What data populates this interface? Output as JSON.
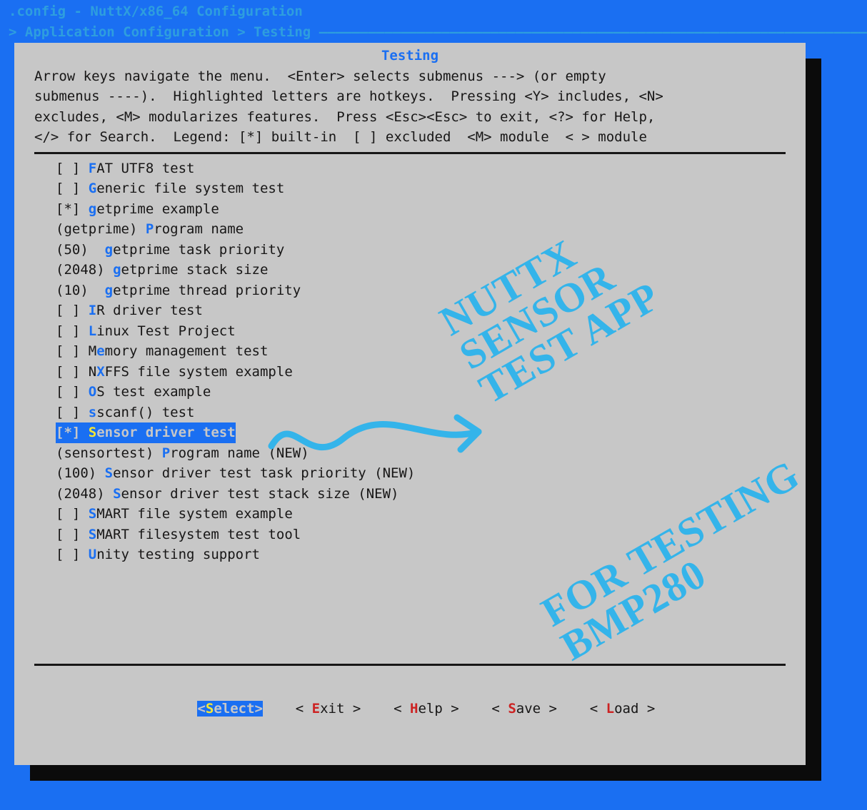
{
  "header": {
    "line1": ".config - NuttX/x86_64 Configuration",
    "line2_prefix": "> Application Configuration > Testing ",
    "line2_rule": "—————————————————————————————————————————————————————————————————————————————————"
  },
  "panel": {
    "title": "Testing",
    "help": [
      "Arrow keys navigate the menu.  <Enter> selects submenus ---> (or empty",
      "submenus ----).  Highlighted letters are hotkeys.  Pressing <Y> includes, <N>",
      "excludes, <M> modularizes features.  Press <Esc><Esc> to exit, <?> for Help,",
      "</> for Search.  Legend: [*] built-in  [ ] excluded  <M> module  < > module"
    ]
  },
  "items": [
    {
      "prefix": "[ ] ",
      "hk": "F",
      "rest": "AT UTF8 test",
      "selected": false
    },
    {
      "prefix": "[ ] ",
      "hk": "G",
      "rest": "eneric file system test",
      "selected": false
    },
    {
      "prefix": "[*] ",
      "hk": "g",
      "rest": "etprime example",
      "selected": false
    },
    {
      "prefix": "(getprime) ",
      "hk": "P",
      "rest": "rogram name",
      "selected": false
    },
    {
      "prefix": "(50)  ",
      "hk": "g",
      "rest": "etprime task priority",
      "selected": false
    },
    {
      "prefix": "(2048) ",
      "hk": "g",
      "rest": "etprime stack size",
      "selected": false
    },
    {
      "prefix": "(10)  ",
      "hk": "g",
      "rest": "etprime thread priority",
      "selected": false
    },
    {
      "prefix": "[ ] ",
      "hk": "I",
      "rest": "R driver test",
      "selected": false
    },
    {
      "prefix": "[ ] ",
      "hk": "L",
      "rest": "inux Test Project",
      "selected": false
    },
    {
      "prefix": "[ ] M",
      "hk": "e",
      "rest": "mory management test",
      "selected": false
    },
    {
      "prefix": "[ ] N",
      "hk": "X",
      "rest": "FFS file system example",
      "selected": false
    },
    {
      "prefix": "[ ] ",
      "hk": "O",
      "rest": "S test example",
      "selected": false
    },
    {
      "prefix": "[ ] ",
      "hk": "s",
      "rest": "scanf() test",
      "selected": false
    },
    {
      "prefix": "[*] ",
      "hk": "S",
      "rest": "ensor driver test",
      "selected": true
    },
    {
      "prefix": "(sensortest) ",
      "hk": "P",
      "rest": "rogram name (NEW)",
      "selected": false
    },
    {
      "prefix": "(100) ",
      "hk": "S",
      "rest": "ensor driver test task priority (NEW)",
      "selected": false
    },
    {
      "prefix": "(2048) ",
      "hk": "S",
      "rest": "ensor driver test stack size (NEW)",
      "selected": false
    },
    {
      "prefix": "[ ] ",
      "hk": "S",
      "rest": "MART file system example",
      "selected": false
    },
    {
      "prefix": "[ ] ",
      "hk": "S",
      "rest": "MART filesystem test tool",
      "selected": false
    },
    {
      "prefix": "[ ] ",
      "hk": "U",
      "rest": "nity testing support",
      "selected": false
    }
  ],
  "buttons": {
    "select": {
      "open": "<",
      "hk": "S",
      "rest": "elect",
      "close": ">"
    },
    "exit": {
      "open": "< ",
      "hk": "E",
      "rest": "xit ",
      "close": ">"
    },
    "help": {
      "open": "< ",
      "hk": "H",
      "rest": "elp ",
      "close": ">"
    },
    "save": {
      "open": "< ",
      "hk": "S",
      "rest": "ave ",
      "close": ">"
    },
    "load": {
      "open": "< ",
      "hk": "L",
      "rest": "oad ",
      "close": ">"
    },
    "gap": "    "
  },
  "annotations": {
    "block1": "NUTTX\nSENSOR\nTEST APP",
    "block2": "FOR TESTING\nBMP280"
  }
}
